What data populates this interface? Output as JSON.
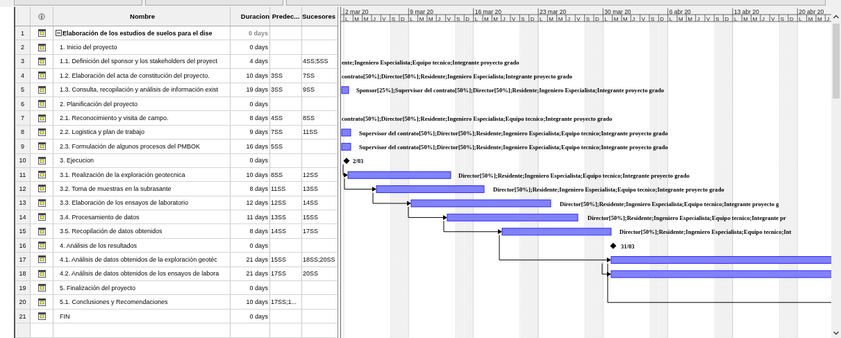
{
  "table": {
    "columns": [
      "Nombre",
      "Duracion",
      "Predec...",
      "Sucesores"
    ],
    "rows": [
      {
        "id": "1",
        "name": "Elaboración de los estudios de suelos para el dise",
        "duration": "0 days",
        "expanded": true,
        "children": [
          {
            "id": "2",
            "name": "1. Inicio del proyecto",
            "duration": "0 days"
          },
          {
            "id": "3",
            "name": "1.1. Definición del sponsor y los stakeholders del proyect",
            "duration": "4 days",
            "successors": "4SS;5SS",
            "bar": {
              "kind": "label",
              "label": "ente;Ingeniero Especialista;Equipo tecnico;Integrante proyecto grado"
            }
          },
          {
            "id": "4",
            "name": "1.2. Elaboración del acta de constitución del proyecto.",
            "duration": "10 days",
            "predecessors": "3SS",
            "successors": "7SS",
            "bar": {
              "kind": "label",
              "label": "contrato[50%];Director[50%];Residente;Ingeniero Especialista;Integrante proyecto grado"
            }
          },
          {
            "id": "5",
            "name": "1.3. Consulta, recopilación y análisis de información exist",
            "duration": "19 days",
            "predecessors": "3SS",
            "successors": "9SS",
            "bar": {
              "kind": "task",
              "label": "Sponsor[25%];Supervisor del contrato[50%];Director[50%];Residente;Ingeniero Especialista;Integrante proyecto grado"
            }
          },
          {
            "id": "6",
            "name": "2. Planificación del proyecto",
            "duration": "0 days"
          },
          {
            "id": "7",
            "name": "2.1. Reconocimiento y visita de campo.",
            "duration": "8 days",
            "predecessors": "4SS",
            "successors": "8SS",
            "bar": {
              "kind": "label",
              "label": "contrato[50%];Director[50%];Residente;Ingeniero Especialista;Equipo tecnico;Integrante proyecto grado"
            }
          },
          {
            "id": "8",
            "name": "2.2. Logistica y plan de trabajo",
            "duration": "9 days",
            "predecessors": "7SS",
            "successors": "11SS",
            "bar": {
              "kind": "task",
              "label": "Supervisor del contrato[50%];Director[50%];Residente;Ingeniero Especialista;Equipo tecnico;Integrante proyecto grado"
            }
          },
          {
            "id": "9",
            "name": "2.3. Formulación de algunos procesos del PMBOK",
            "duration": "16 days",
            "predecessors": "5SS",
            "bar": {
              "kind": "task",
              "label": "Supervisor del contrato[50%];Director[50%];Residente;Ingeniero Especialista;Equipo tecnico;Integrante proyecto grado"
            }
          },
          {
            "id": "10",
            "name": "3. Ejecucion",
            "duration": "0 days",
            "bar": {
              "kind": "milestone",
              "label": "2/03"
            }
          },
          {
            "id": "11",
            "name": "3.1. Realización de la exploración geotecnica",
            "duration": "10 days",
            "predecessors": "8SS",
            "successors": "12SS",
            "bar": {
              "kind": "task",
              "label": "Director[50%];Residente;Ingeniero Especialista;Equipo tecnico;Integrante proyecto grado"
            }
          },
          {
            "id": "12",
            "name": "3.2. Toma de muestras en la subrasante",
            "duration": "8 days",
            "predecessors": "11SS",
            "successors": "13SS",
            "bar": {
              "kind": "task",
              "label": "Director[50%];Residente;Ingeniero Especialista;Equipo tecnico;Integrante proyecto grado"
            }
          },
          {
            "id": "13",
            "name": "3.3. Elaboración de los ensayos de laboratorio",
            "duration": "12 days",
            "predecessors": "12SS",
            "successors": "14SS",
            "bar": {
              "kind": "task",
              "label": "Director[50%];Residente;Ingeniero Especialista;Equipo tecnico;Integrante proyecto g"
            }
          },
          {
            "id": "14",
            "name": "3.4. Procesamiento de datos",
            "duration": "11 days",
            "predecessors": "13SS",
            "successors": "15SS",
            "bar": {
              "kind": "task",
              "label": "Director[50%];Residente;Ingeniero Especialista;Equipo tecnico;Integrante pr"
            }
          },
          {
            "id": "15",
            "name": "3.5. Recopilación de datos obtenidos",
            "duration": "8 days",
            "predecessors": "14SS",
            "successors": "17SS",
            "bar": {
              "kind": "task",
              "label": "Director[50%];Residente;Ingeniero Especialista;Equipo tecnico;Int"
            }
          },
          {
            "id": "16",
            "name": "4. Análisis de los resultados",
            "duration": "0 days",
            "bar": {
              "kind": "milestone",
              "label": "31/03"
            }
          },
          {
            "id": "17",
            "name": "4.1. Análisis de datos obtenidos de la exploración geotéc",
            "duration": "21 days",
            "predecessors": "15SS",
            "successors": "18SS;20SS",
            "bar": {
              "kind": "task"
            }
          },
          {
            "id": "18",
            "name": "4.2. Análisis de datos obtenidos de los ensayos de labora",
            "duration": "21 days",
            "predecessors": "17SS",
            "successors": "20SS",
            "bar": {
              "kind": "task"
            }
          },
          {
            "id": "19",
            "name": "5. Finalización del proyecto",
            "duration": "0 days"
          },
          {
            "id": "20",
            "name": "5.1. Conclusiones y Recomendaciones",
            "duration": "10 days",
            "predecessors": "17SS;1..."
          },
          {
            "id": "21",
            "name": "FIN",
            "duration": "0 days"
          }
        ]
      }
    ]
  },
  "timeline": {
    "weeks": [
      {
        "label": "2 mar 20",
        "days": [
          "L",
          "M",
          "M",
          "J",
          "V",
          "S",
          "D"
        ]
      },
      {
        "label": "9 mar 20",
        "days": [
          "L",
          "M",
          "M",
          "J",
          "V",
          "S",
          "D"
        ]
      },
      {
        "label": "16 mar 20",
        "days": [
          "L",
          "M",
          "M",
          "J",
          "V",
          "S",
          "D"
        ]
      },
      {
        "label": "23 mar 20",
        "days": [
          "L",
          "M",
          "M",
          "J",
          "V",
          "S",
          "D"
        ]
      },
      {
        "label": "30 mar 20",
        "days": [
          "L",
          "M",
          "M",
          "J",
          "V",
          "S",
          "D"
        ]
      },
      {
        "label": "6 abr 20",
        "days": [
          "L",
          "M",
          "M",
          "J",
          "V",
          "S",
          "D"
        ]
      },
      {
        "label": "13 abr 20",
        "days": [
          "L",
          "M",
          "M",
          "J",
          "V",
          "S",
          "D"
        ]
      },
      {
        "label": "20 abr 20",
        "days": [
          "L",
          "M",
          "M",
          "J"
        ]
      }
    ]
  }
}
